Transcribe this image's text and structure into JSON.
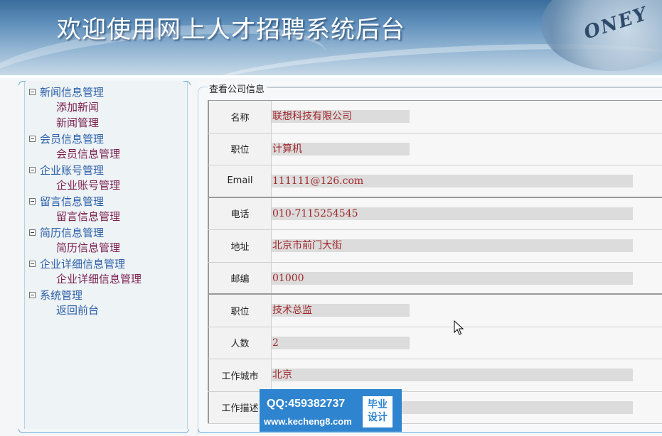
{
  "header": {
    "title": "欢迎使用网上人才招聘系统后台",
    "seal_text": "ONEY"
  },
  "sidebar": {
    "groups": [
      {
        "label": "新闻信息管理",
        "items": [
          {
            "label": "添加新闻",
            "color": "#7a1f4e"
          },
          {
            "label": "新闻管理",
            "color": "#7a1f4e"
          }
        ]
      },
      {
        "label": "会员信息管理",
        "items": [
          {
            "label": "会员信息管理",
            "color": "#7a1f4e"
          }
        ]
      },
      {
        "label": "企业账号管理",
        "items": [
          {
            "label": "企业账号管理",
            "color": "#7a1f4e"
          }
        ]
      },
      {
        "label": "留言信息管理",
        "items": [
          {
            "label": "留言信息管理",
            "color": "#7a1f4e"
          }
        ]
      },
      {
        "label": "简历信息管理",
        "items": [
          {
            "label": "简历信息管理",
            "color": "#7a1f4e"
          }
        ]
      },
      {
        "label": "企业详细信息管理",
        "items": [
          {
            "label": "企业详细信息管理",
            "color": "#7a1f4e"
          }
        ]
      },
      {
        "label": "系统管理",
        "items": [
          {
            "label": "返回前台",
            "color": "#2b5fa8"
          }
        ]
      }
    ]
  },
  "main": {
    "legend": "查看公司信息",
    "rows": [
      {
        "label": "名称",
        "value": "联想科技有限公司"
      },
      {
        "label": "职位",
        "value": "计算机"
      },
      {
        "label": "Email",
        "value": "111111@126.com"
      },
      {
        "label": "电话",
        "value": "010-7115254545"
      },
      {
        "label": "地址",
        "value": "北京市前门大街"
      },
      {
        "label": "邮编",
        "value": "01000"
      },
      {
        "label": "职位",
        "value": "技术总监"
      },
      {
        "label": "人数",
        "value": "2"
      },
      {
        "label": "工作城市",
        "value": "北京"
      },
      {
        "label": "工作描述",
        "value": ""
      }
    ]
  },
  "watermark": {
    "qq": "QQ:459382737",
    "url": "www.kecheng8.com",
    "badge_line1": "毕业",
    "badge_line2": "设计"
  },
  "colors": {
    "value_text": "#a0282d",
    "menu_head": "#2b5fa8",
    "menu_link": "#7a1f4e",
    "watermark_bg": "#2e84cf"
  }
}
